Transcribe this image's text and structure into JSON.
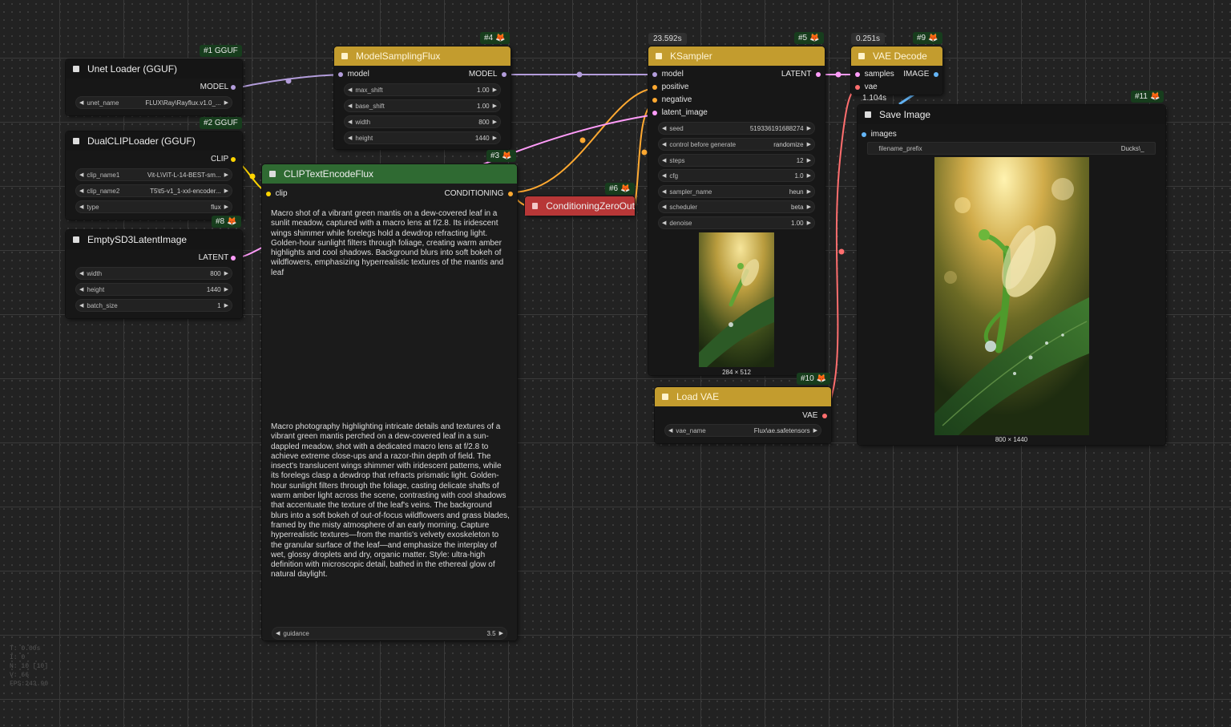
{
  "nodes": {
    "unet": {
      "badge": "#1 GGUF",
      "title": "Unet Loader (GGUF)",
      "out": "MODEL",
      "widgets": [
        {
          "label": "unet_name",
          "value": "FLUX\\Ray\\Rayflux.v1.0_..."
        }
      ]
    },
    "dualclip": {
      "badge": "#2 GGUF",
      "title": "DualCLIPLoader (GGUF)",
      "out": "CLIP",
      "widgets": [
        {
          "label": "clip_name1",
          "value": "Vit-L\\ViT-L-14-BEST-sm..."
        },
        {
          "label": "clip_name2",
          "value": "T5\\t5-v1_1-xxl-encoder..."
        },
        {
          "label": "type",
          "value": "flux"
        }
      ]
    },
    "latent": {
      "badge": "#8",
      "title": "EmptySD3LatentImage",
      "out": "LATENT",
      "widgets": [
        {
          "label": "width",
          "value": "800"
        },
        {
          "label": "height",
          "value": "1440"
        },
        {
          "label": "batch_size",
          "value": "1"
        }
      ]
    },
    "msf": {
      "badge": "#4",
      "title": "ModelSamplingFlux",
      "in": "model",
      "out": "MODEL",
      "widgets": [
        {
          "label": "max_shift",
          "value": "1.00"
        },
        {
          "label": "base_shift",
          "value": "1.00"
        },
        {
          "label": "width",
          "value": "800"
        },
        {
          "label": "height",
          "value": "1440"
        }
      ]
    },
    "clipenc": {
      "badge": "#3",
      "title": "CLIPTextEncodeFlux",
      "in": "clip",
      "out": "CONDITIONING",
      "prompt1": "Macro shot of a vibrant green mantis on a dew-covered leaf in a sunlit meadow, captured with a macro lens at f/2.8. Its iridescent wings shimmer while forelegs hold a dewdrop refracting light. Golden-hour sunlight filters through foliage, creating warm amber highlights and cool shadows. Background blurs into soft bokeh of wildflowers, emphasizing hyperrealistic textures of the mantis and leaf",
      "prompt2": "Macro photography highlighting intricate details and textures of a vibrant green mantis perched on a dew-covered leaf in a sun-dappled meadow, shot with a dedicated macro lens at f/2.8 to achieve extreme close-ups and a razor-thin depth of field. The insect's translucent wings shimmer with iridescent patterns, while its forelegs clasp a dewdrop that refracts prismatic light. Golden-hour sunlight filters through the foliage, casting delicate shafts of warm amber light across the scene, contrasting with cool shadows that accentuate the texture of the leaf's veins. The background blurs into a soft bokeh of out-of-focus wildflowers and grass blades, framed by the misty atmosphere of an early morning. Capture hyperrealistic textures—from the mantis's velvety exoskeleton to the granular surface of the leaf—and emphasize the interplay of wet, glossy droplets and dry, organic matter. Style: ultra-high definition with microscopic detail, bathed in the ethereal glow of natural daylight.",
      "guidance": {
        "label": "guidance",
        "value": "3.5"
      }
    },
    "czo": {
      "badge": "#6",
      "title": "ConditioningZeroOut"
    },
    "ksampler": {
      "badge": "#5",
      "time": "23.592s",
      "title": "KSampler",
      "out": "LATENT",
      "inputs": [
        "model",
        "positive",
        "negative",
        "latent_image"
      ],
      "widgets": [
        {
          "label": "seed",
          "value": "519336191688274"
        },
        {
          "label": "control before generate",
          "value": "randomize"
        },
        {
          "label": "steps",
          "value": "12"
        },
        {
          "label": "cfg",
          "value": "1.0"
        },
        {
          "label": "sampler_name",
          "value": "heun"
        },
        {
          "label": "scheduler",
          "value": "beta"
        },
        {
          "label": "denoise",
          "value": "1.00"
        }
      ],
      "preview_caption": "284 × 512"
    },
    "loadvae": {
      "badge": "#10",
      "title": "Load VAE",
      "out": "VAE",
      "widgets": [
        {
          "label": "vae_name",
          "value": "Flux\\ae.safetensors"
        }
      ]
    },
    "vaedecode": {
      "badge": "#9",
      "time": "0.251s",
      "title": "VAE Decode",
      "in1": "samples",
      "in2": "vae",
      "out": "IMAGE",
      "extra_time": "1.104s"
    },
    "save": {
      "badge": "#11",
      "title": "Save Image",
      "in": "images",
      "widgets": [
        {
          "label": "filename_prefix",
          "value": "Ducks\\_"
        }
      ],
      "caption": "800 × 1440"
    }
  },
  "stats": [
    "T: 0.00s",
    "I: 0",
    "N: 10 [10]",
    "V: 66",
    "FPS:243.90"
  ],
  "colors": {
    "model": "#b39ddb",
    "clip": "#ffd500",
    "conditioning": "#ffa931",
    "latent": "#ff9cf9",
    "vae": "#ff6e6e",
    "image": "#64b5f6",
    "gold": "#c39c2e",
    "green": "#2f6a32",
    "red": "#b73737"
  }
}
